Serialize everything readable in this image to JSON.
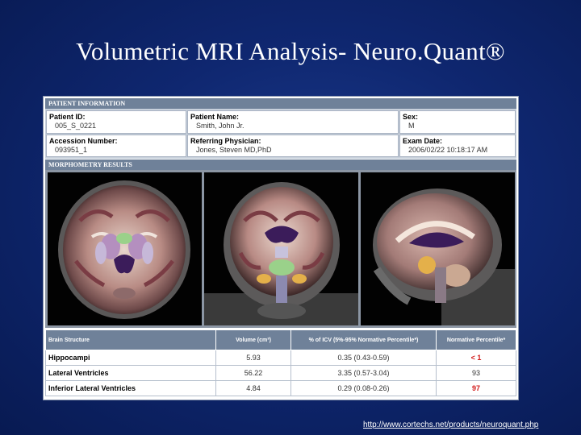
{
  "slide": {
    "title": "Volumetric MRI Analysis- Neuro.Quant®",
    "url": "http://www.cortechs.net/products/neuroquant.php"
  },
  "patient_info": {
    "header": "PATIENT INFORMATION",
    "patient_id_label": "Patient ID:",
    "patient_id": "005_S_0221",
    "patient_name_label": "Patient Name:",
    "patient_name": "Smith, John Jr.",
    "sex_label": "Sex:",
    "sex": "M",
    "accession_label": "Accession Number:",
    "accession": "093951_1",
    "physician_label": "Referring Physician:",
    "physician": "Jones, Steven MD,PhD",
    "exam_date_label": "Exam Date:",
    "exam_date": "2006/02/22 10:18:17 AM"
  },
  "morphometry": {
    "header": "MORPHOMETRY RESULTS",
    "images": [
      "axial-brain-slice",
      "coronal-brain-slice",
      "sagittal-brain-slice"
    ],
    "columns": [
      "Brain Structure",
      "Volume (cm³)",
      "% of ICV (5%-95% Normative Percentile*)",
      "Normative Percentile*"
    ],
    "rows": [
      {
        "structure": "Hippocampi",
        "volume": "5.93",
        "icv": "0.35 (0.43-0.59)",
        "percentile": "< 1",
        "flag": true
      },
      {
        "structure": "Lateral Ventricles",
        "volume": "56.22",
        "icv": "3.35 (0.57-3.04)",
        "percentile": "93",
        "flag": false
      },
      {
        "structure": "Inferior Lateral Ventricles",
        "volume": "4.84",
        "icv": "0.29 (0.08-0.26)",
        "percentile": "97",
        "flag": true
      }
    ]
  },
  "colors": {
    "background": "#0f2770",
    "header_bar": "#6f8199",
    "flag_red": "#d11a1a"
  }
}
